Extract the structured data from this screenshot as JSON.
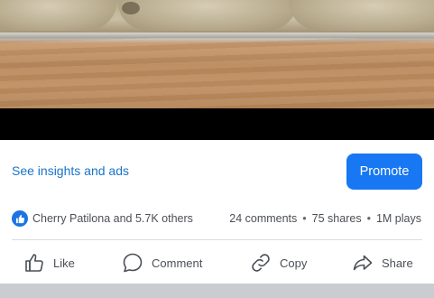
{
  "post": {
    "insights_link": "See insights and ads",
    "promote_label": "Promote",
    "reactions_text": "Cherry Patilona and 5.7K others",
    "comments": "24 comments",
    "shares": "75 shares",
    "plays": "1M plays",
    "separator": "•"
  },
  "actions": {
    "like": "Like",
    "comment": "Comment",
    "copy": "Copy",
    "share": "Share"
  },
  "colors": {
    "accent": "#1877f2",
    "link": "#1a74c9",
    "text_secondary": "#4b4f56"
  }
}
